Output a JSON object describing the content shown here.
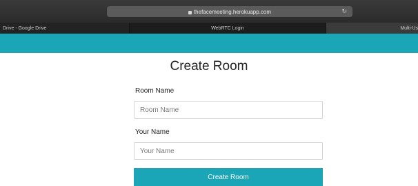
{
  "browser": {
    "url": "thefacemeeting.herokuapp.com",
    "tabs": [
      {
        "label": "Drive - Google Drive"
      },
      {
        "label": "WebRTC Login"
      },
      {
        "label": "Multi-Us"
      }
    ]
  },
  "page": {
    "title": "Create Room",
    "room_name_label": "Room Name",
    "room_name_placeholder": "Room Name",
    "room_name_value": "",
    "your_name_label": "Your Name",
    "your_name_placeholder": "Your Name",
    "your_name_value": "",
    "submit_label": "Create Room"
  },
  "colors": {
    "accent": "#1ba6b7",
    "browser_chrome": "#2b2b2b"
  }
}
